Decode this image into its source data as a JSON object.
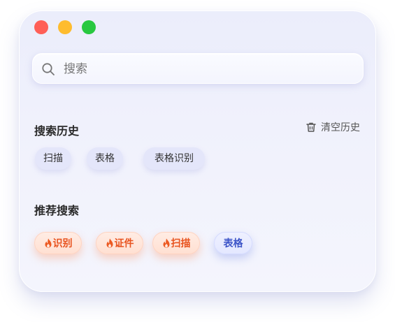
{
  "window": {
    "controls": [
      "close",
      "minimize",
      "maximize"
    ]
  },
  "search": {
    "placeholder": "搜索",
    "icon": "search-icon"
  },
  "history": {
    "title": "搜索历史",
    "clear_label": "清空历史",
    "clear_icon": "trash-icon",
    "items": [
      "扫描",
      "表格",
      "表格识别"
    ]
  },
  "recommended": {
    "title": "推荐搜索",
    "items": [
      {
        "label": "识别",
        "hot": true
      },
      {
        "label": "证件",
        "hot": true
      },
      {
        "label": "扫描",
        "hot": true
      },
      {
        "label": "表格",
        "hot": false
      }
    ]
  },
  "colors": {
    "hot": "#e8531f",
    "blue": "#3d55c8",
    "close": "#ff5f57",
    "minimize": "#febc2e",
    "maximize": "#28c840"
  }
}
